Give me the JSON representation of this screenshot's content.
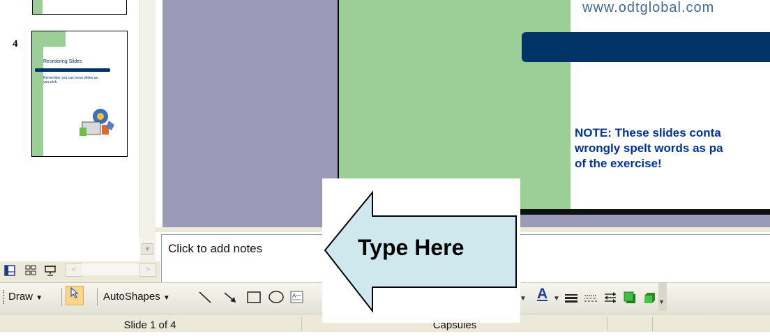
{
  "thumbnails": {
    "slide_number": "4",
    "slide_title": "Reordering Slides",
    "slide_bullet": "Remember you can move slides as you wish."
  },
  "slide": {
    "url_text": "www.odtglobal.com",
    "note_text": "NOTE: These slides conta\nwrongly spelt words as pa\nof the exercise!"
  },
  "notes": {
    "placeholder": "Click to add notes"
  },
  "callout": {
    "text": "Type Here",
    "fill": "#cfe8ee"
  },
  "drawbar": {
    "draw_label": "Draw",
    "autoshapes_label": "AutoShapes",
    "font_color_letter": "A",
    "font_color": "#1c3e9c"
  },
  "status": {
    "slide_position": "Slide 1 of 4",
    "design": "Capsules"
  },
  "colors": {
    "slide_green": "#9ccf98",
    "slide_navy": "#003366",
    "workspace": "#9b9ab8",
    "highlight": "#fbd58a"
  }
}
